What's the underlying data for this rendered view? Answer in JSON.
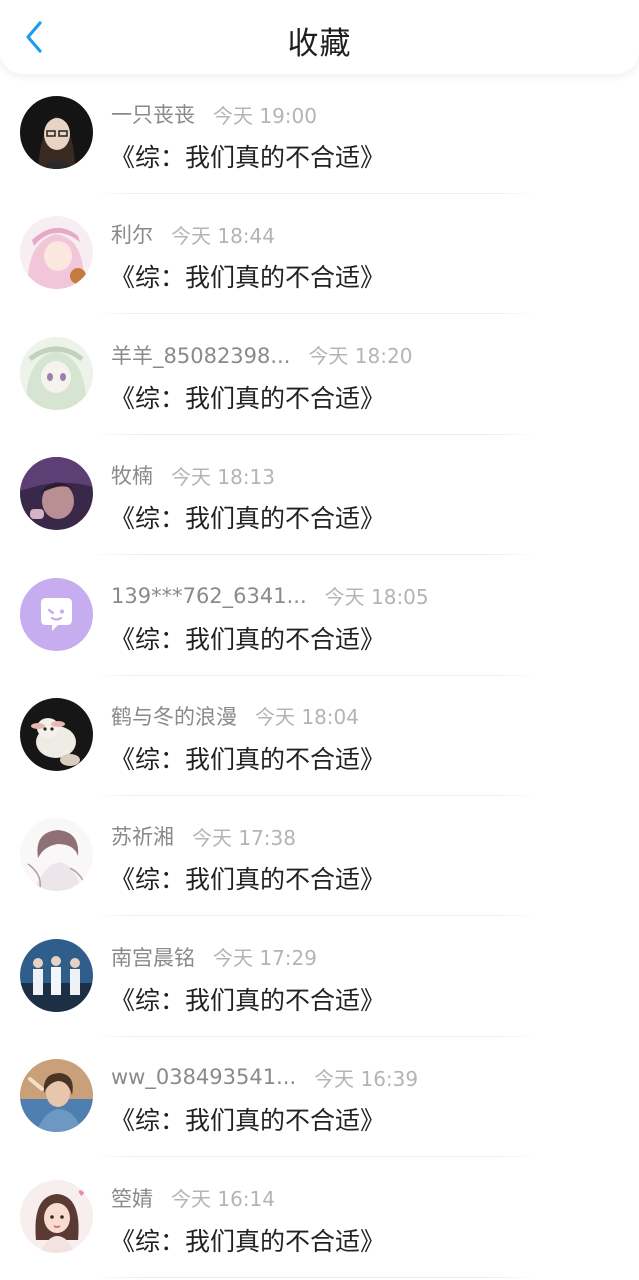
{
  "header": {
    "title": "收藏",
    "back_icon": "chevron-left-icon",
    "accent": "#1d9bf0"
  },
  "items": [
    {
      "name": "一只丧丧",
      "time": "今天 19:00",
      "content": "《综：我们真的不合适》",
      "avatar": "dark"
    },
    {
      "name": "利尔",
      "time": "今天 18:44",
      "content": "《综：我们真的不合适》",
      "avatar": "pink"
    },
    {
      "name": "羊羊_85082398...",
      "time": "今天 18:20",
      "content": "《综：我们真的不合适》",
      "avatar": "mint"
    },
    {
      "name": "牧楠",
      "time": "今天 18:13",
      "content": "《综：我们真的不合适》",
      "avatar": "purple-dark"
    },
    {
      "name": "139***762_6341...",
      "time": "今天 18:05",
      "content": "《综：我们真的不合适》",
      "avatar": "default-chat"
    },
    {
      "name": "鹤与冬的浪漫",
      "time": "今天 18:04",
      "content": "《综：我们真的不合适》",
      "avatar": "sheep"
    },
    {
      "name": "苏祈湘",
      "time": "今天 17:38",
      "content": "《综：我们真的不合适》",
      "avatar": "sketch"
    },
    {
      "name": "南宫晨铭",
      "time": "今天 17:29",
      "content": "《综：我们真的不合适》",
      "avatar": "group"
    },
    {
      "name": "ww_038493541...",
      "time": "今天 16:39",
      "content": "《综：我们真的不合适》",
      "avatar": "girl-blue"
    },
    {
      "name": "箜婧",
      "time": "今天 16:14",
      "content": "《综：我们真的不合适》",
      "avatar": "girl-illustration"
    }
  ]
}
